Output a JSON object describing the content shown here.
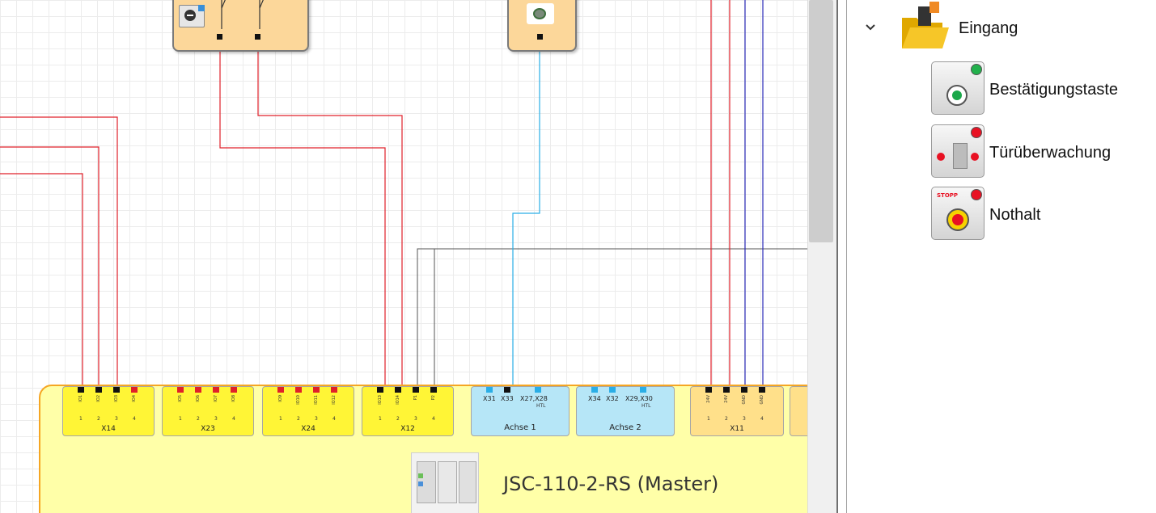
{
  "colors": {
    "wire_red": "#e0202a",
    "wire_blue": "#2a2ab8",
    "wire_cyan": "#2aaee6",
    "wire_gray": "#555555",
    "module_fill": "#ffffa8",
    "module_border": "#f5a623",
    "block_fill": "#fcd79a"
  },
  "canvas": {
    "terminals": [
      {
        "name": "X14",
        "pins": [
          "IO1",
          "IO2",
          "IO3",
          "IO4"
        ],
        "numbers": [
          "1",
          "2",
          "3",
          "4"
        ],
        "pin_colors": [
          "black",
          "black",
          "black",
          "red"
        ]
      },
      {
        "name": "X23",
        "pins": [
          "IO5",
          "IO6",
          "IO7",
          "IO8"
        ],
        "numbers": [
          "1",
          "2",
          "3",
          "4"
        ],
        "pin_colors": [
          "red",
          "red",
          "red",
          "red"
        ]
      },
      {
        "name": "X24",
        "pins": [
          "IO9",
          "IO10",
          "IO11",
          "IO12"
        ],
        "numbers": [
          "1",
          "2",
          "3",
          "4"
        ],
        "pin_colors": [
          "red",
          "red",
          "red",
          "red"
        ]
      },
      {
        "name": "X12",
        "pins": [
          "IO13",
          "IO14",
          "P1",
          "P2"
        ],
        "numbers": [
          "1",
          "2",
          "3",
          "4"
        ],
        "pin_colors": [
          "black",
          "black",
          "black",
          "black"
        ]
      },
      {
        "name": "Achse 1",
        "pins": [
          "X31",
          "X33",
          "X27,X28"
        ],
        "htl": "HTL"
      },
      {
        "name": "Achse 2",
        "pins": [
          "X34",
          "X32",
          "X29,X30"
        ],
        "htl": "HTL"
      },
      {
        "name": "X11",
        "pins": [
          "24V",
          "24V",
          "GND",
          "GND"
        ],
        "numbers": [
          "1",
          "2",
          "3",
          "4"
        ],
        "pin_colors": [
          "black",
          "black",
          "black",
          "black"
        ]
      }
    ],
    "module_title": "JSC-110-2-RS (Master)"
  },
  "panel": {
    "group_label": "Eingang",
    "chevron_icon": "chevron-down-icon",
    "folder_icon": "folder-open-icon",
    "items": [
      {
        "label": "Bestätigungstaste",
        "icon": "confirm-button-icon",
        "led": "#22b14c"
      },
      {
        "label": "Türüberwachung",
        "icon": "door-monitor-icon",
        "led": "#e81123"
      },
      {
        "label": "Nothalt",
        "icon": "emergency-stop-icon",
        "led": "#e81123",
        "badge": "STOPP"
      }
    ]
  }
}
